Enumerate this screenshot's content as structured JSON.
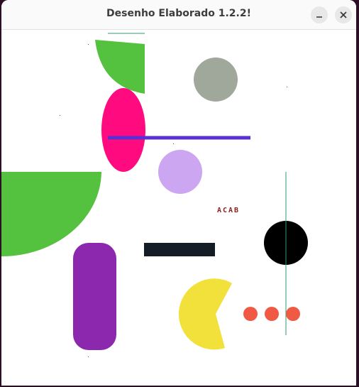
{
  "window": {
    "title": "Desenho Elaborado 1.2.2!",
    "buttons": {
      "minimize": "minimize",
      "close": "close"
    }
  },
  "canvas": {
    "label_text": "ACAB",
    "colors": {
      "green": "#55c23f",
      "magenta": "#ff0a7f",
      "gray_circle": "#9fa89b",
      "blue_line": "#5a2fd6",
      "lavender": "#cda6f2",
      "label_red": "#8b1d1d",
      "purple": "#8b28ad",
      "navy_bar": "#141c26",
      "black": "#000000",
      "teal_line": "#2f9a6b",
      "yellow": "#f2e13a",
      "dots": "#f05a45"
    }
  }
}
